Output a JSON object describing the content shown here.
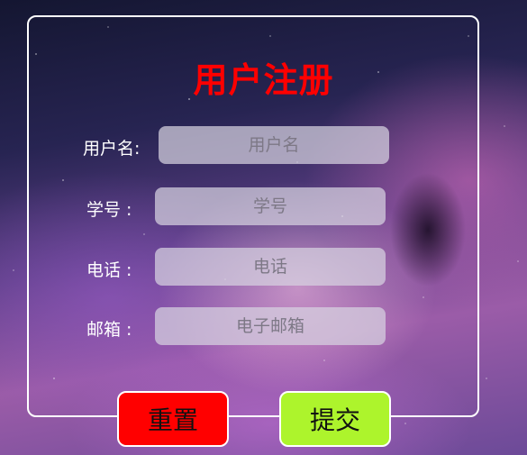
{
  "form": {
    "title": "用户注册",
    "fields": [
      {
        "label": "用户名:",
        "placeholder": "用户名"
      },
      {
        "label": "学号 :",
        "placeholder": "学号"
      },
      {
        "label": "电话 :",
        "placeholder": "电话"
      },
      {
        "label": "邮箱 :",
        "placeholder": "电子邮箱"
      }
    ],
    "reset_label": "重置",
    "submit_label": "提交"
  },
  "colors": {
    "title": "#ff0000",
    "reset_button": "#ff0000",
    "submit_button": "#adf42c",
    "panel_border": "#ffffff"
  }
}
